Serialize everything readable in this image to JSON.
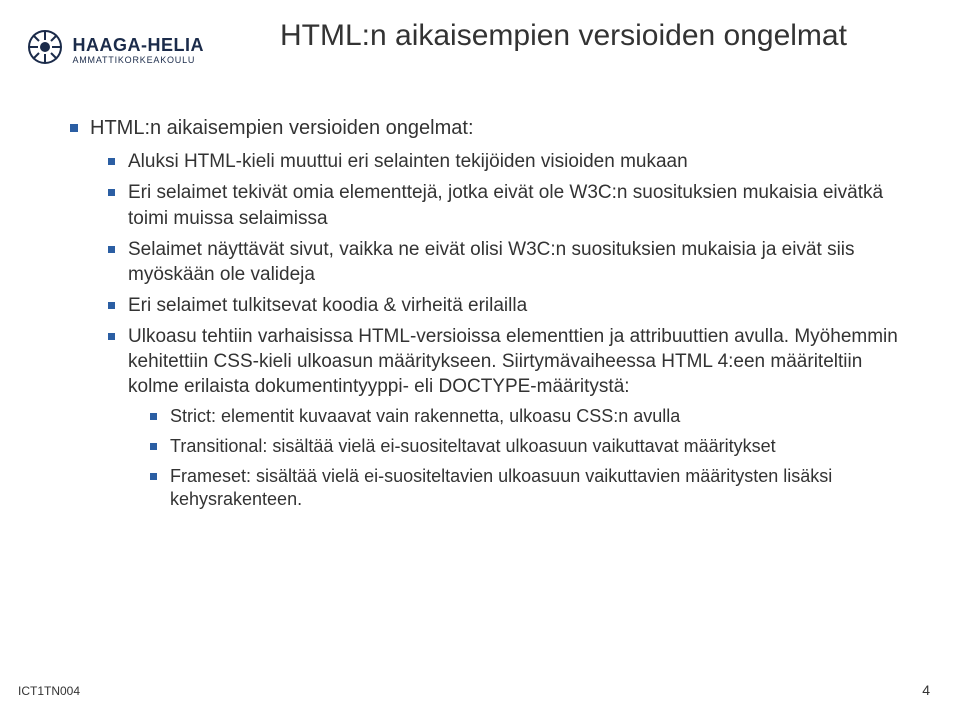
{
  "logo": {
    "name": "HAAGA-HELIA",
    "subtitle": "AMMATTIKORKEAKOULU"
  },
  "title": "HTML:n aikaisempien versioiden ongelmat",
  "bullets": [
    {
      "text": "HTML:n aikaisempien versioiden ongelmat:",
      "children": [
        {
          "text": "Aluksi HTML-kieli muuttui eri selainten tekijöiden visioiden mukaan"
        },
        {
          "text": "Eri selaimet tekivät omia elementtejä, jotka eivät ole W3C:n suosituksien mukaisia eivätkä toimi muissa selaimissa"
        },
        {
          "text": "Selaimet näyttävät sivut, vaikka ne eivät olisi W3C:n suosituksien mukaisia ja eivät siis myöskään ole valideja"
        },
        {
          "text": "Eri selaimet tulkitsevat koodia & virheitä erilailla"
        },
        {
          "text": "Ulkoasu tehtiin varhaisissa HTML-versioissa elementtien ja attribuuttien avulla. Myöhemmin kehitettiin CSS-kieli ulkoasun määritykseen. Siirtymävaiheessa HTML 4:een  määriteltiin kolme erilaista dokumentintyyppi- eli DOCTYPE-määritystä:",
          "children": [
            {
              "text": "Strict: elementit kuvaavat vain rakennetta, ulkoasu CSS:n avulla"
            },
            {
              "text": "Transitional: sisältää vielä ei-suositeltavat ulkoasuun vaikuttavat määritykset"
            },
            {
              "text": "Frameset: sisältää vielä ei-suositeltavien ulkoasuun vaikuttavien määritysten lisäksi kehysrakenteen."
            }
          ]
        }
      ]
    }
  ],
  "footer": {
    "code": "ICT1TN004",
    "page": "4"
  }
}
